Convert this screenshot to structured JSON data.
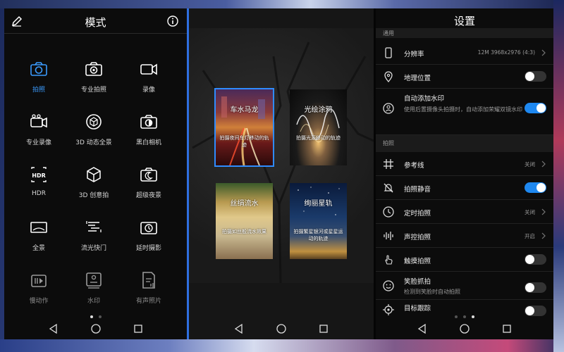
{
  "panel_modes": {
    "title": "模式",
    "modes": [
      {
        "label": "拍照",
        "icon": "camera-icon",
        "state": "active"
      },
      {
        "label": "专业拍照",
        "icon": "pro-camera-icon",
        "state": ""
      },
      {
        "label": "录像",
        "icon": "video-icon",
        "state": ""
      },
      {
        "label": "专业录像",
        "icon": "pro-video-icon",
        "state": ""
      },
      {
        "label": "3D 动态全景",
        "icon": "3d-panorama-icon",
        "state": ""
      },
      {
        "label": "黑白相机",
        "icon": "monochrome-icon",
        "state": ""
      },
      {
        "label": "HDR",
        "icon": "hdr-icon",
        "state": ""
      },
      {
        "label": "3D 创意拍",
        "icon": "3d-cube-icon",
        "state": ""
      },
      {
        "label": "超级夜景",
        "icon": "night-icon",
        "state": ""
      },
      {
        "label": "全景",
        "icon": "panorama-icon",
        "state": ""
      },
      {
        "label": "流光快门",
        "icon": "light-painting-icon",
        "state": ""
      },
      {
        "label": "延时摄影",
        "icon": "timelapse-icon",
        "state": ""
      },
      {
        "label": "慢动作",
        "icon": "slow-motion-icon",
        "state": "dim"
      },
      {
        "label": "水印",
        "icon": "watermark-icon",
        "state": "dim"
      },
      {
        "label": "有声照片",
        "icon": "audio-photo-icon",
        "state": "dim"
      }
    ]
  },
  "panel_light": {
    "cards": [
      {
        "title": "车水马龙",
        "desc": "拍摄夜间车灯移动的轨迹"
      },
      {
        "title": "光绘涂鸦",
        "desc": "拍摄光源移动的轨迹"
      },
      {
        "title": "丝绢流水",
        "desc": "拍摄如丝般流水效果"
      },
      {
        "title": "绚丽星轨",
        "desc": "拍摄繁星银河或星星运动的轨迹"
      }
    ]
  },
  "panel_settings": {
    "title": "设置",
    "sections": {
      "general": "通用",
      "photo": "拍照"
    },
    "rows": {
      "resolution": {
        "label": "分辨率",
        "value": "12M 3968x2976 (4:3)"
      },
      "location": {
        "label": "地理位置",
        "toggle": false
      },
      "watermark": {
        "label": "自动添加水印",
        "sub": "使用后置摄像头拍摄时，自动添加荣耀双镜水印",
        "toggle": true
      },
      "grid": {
        "label": "参考线",
        "value": "关闭"
      },
      "mute": {
        "label": "拍照静音",
        "toggle": true
      },
      "timer": {
        "label": "定时拍照",
        "value": "关闭"
      },
      "voice": {
        "label": "声控拍照",
        "value": "开启"
      },
      "touch": {
        "label": "触摸拍照",
        "toggle": false
      },
      "smile": {
        "label": "笑脸抓拍",
        "sub": "检测到笑脸时自动拍照",
        "toggle": false
      },
      "tracking": {
        "label": "目标跟踪",
        "toggle": false
      }
    }
  },
  "colors": {
    "accent": "#1e88f0",
    "active_mode": "#3b9cff"
  }
}
